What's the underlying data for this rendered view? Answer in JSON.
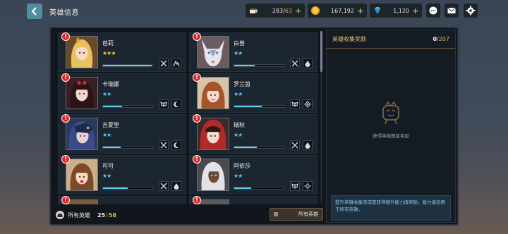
{
  "header": {
    "title": "英雄信息",
    "resources": [
      {
        "icon": "coffee-cup-icon",
        "current": "283",
        "max": "63",
        "separator": "/"
      },
      {
        "icon": "gold-coin-icon",
        "value": "167,192"
      },
      {
        "icon": "gem-icon",
        "value": "1,120"
      }
    ]
  },
  "heroes": [
    {
      "name": "芭莉",
      "stars": "★★★",
      "star_color": "gold",
      "xp": 0.98,
      "roles": [
        "sword-cross-icon",
        "mountain-icon"
      ]
    },
    {
      "name": "白兽",
      "stars": "★★",
      "star_color": "blue",
      "xp": 0.42,
      "roles": [
        "crossed-swords-icon",
        "drop-icon"
      ]
    },
    {
      "name": "卡瑞娜",
      "stars": "★★",
      "star_color": "blue",
      "xp": 0.38,
      "roles": [
        "wings-icon",
        "moon-icon"
      ]
    },
    {
      "name": "罗兰茵",
      "stars": "★★",
      "star_color": "blue",
      "xp": 0.55,
      "roles": [
        "wings-icon",
        "eye-icon"
      ]
    },
    {
      "name": "吉蒙里",
      "stars": "★★",
      "star_color": "blue",
      "xp": 0.36,
      "roles": [
        "sword-cross-icon",
        "moon-icon"
      ]
    },
    {
      "name": "瑞秋",
      "stars": "★★",
      "star_color": "blue",
      "xp": 0.46,
      "roles": [
        "sword-cross-icon",
        "drop-icon"
      ]
    },
    {
      "name": "可可",
      "stars": "★★",
      "star_color": "blue",
      "xp": 0.5,
      "roles": [
        "sword-cross-icon",
        "drop-icon"
      ]
    },
    {
      "name": "阿依莎",
      "stars": "★★",
      "star_color": "blue",
      "xp": 0.34,
      "roles": [
        "wings-icon",
        "sun-icon"
      ]
    }
  ],
  "alert_mark": "!",
  "footer": {
    "label": "所有英雄",
    "owned": "25",
    "separator": "/",
    "total": "58",
    "filter_label": "所有英雄"
  },
  "reward_panel": {
    "title": "英雄收集奖励",
    "current": "0",
    "separator": "/",
    "max": "207",
    "empty_text": "获得英雄图鉴奖励",
    "description": "提升英雄收集完成度获得额外能力值奖励。能力值适用于所有英雄。"
  },
  "colors": {
    "accent": "#5ad0ee",
    "gold": "#e0b34a",
    "alert": "#e02828"
  }
}
